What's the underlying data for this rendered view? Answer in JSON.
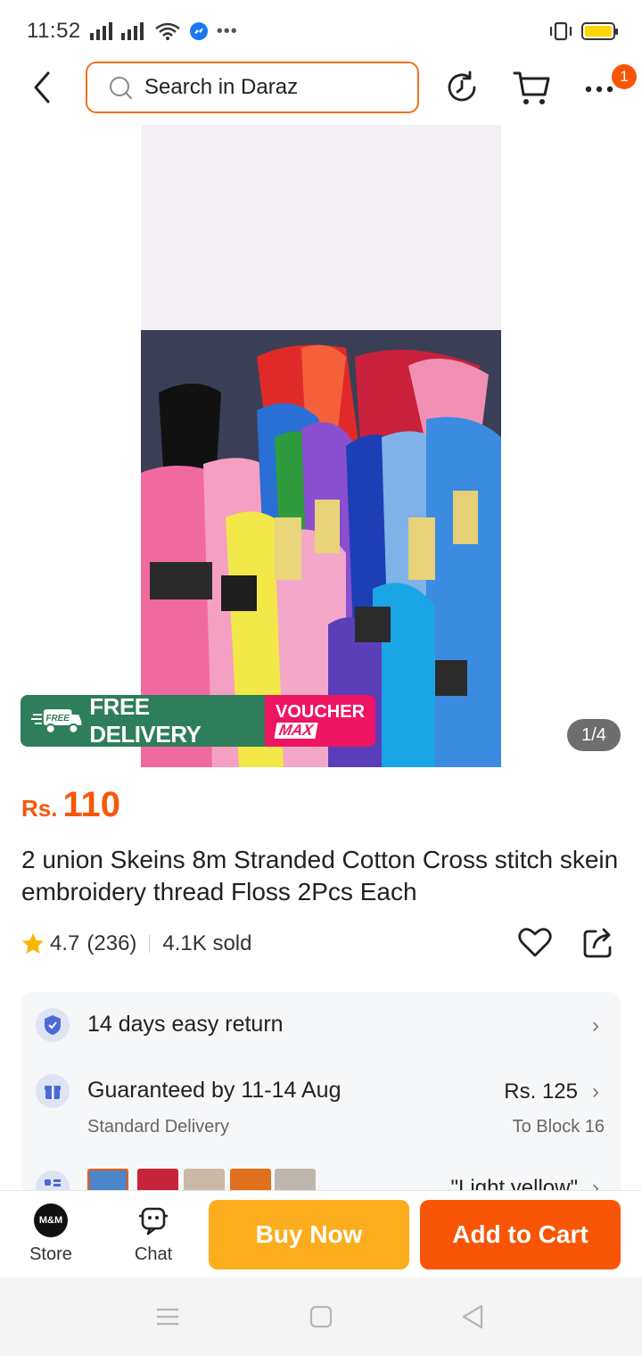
{
  "status_bar": {
    "time": "11:52"
  },
  "header": {
    "search_placeholder": "Search in Daraz",
    "notification_count": "1"
  },
  "gallery": {
    "counter": "1/4",
    "promo_free_delivery": "FREE DELIVERY",
    "promo_free_badge": "FREE",
    "promo_voucher": "VOUCHER",
    "promo_max": "MAX"
  },
  "product": {
    "currency": "Rs.",
    "price": "110",
    "title": "2 union Skeins 8m Stranded Cotton Cross stitch skein embroidery thread Floss 2Pcs Each",
    "rating": "4.7",
    "review_count": "(236)",
    "sold": "4.1K sold"
  },
  "info": {
    "return_policy": "14 days easy return",
    "delivery_guarantee": "Guaranteed by 11-14 Aug",
    "delivery_type": "Standard Delivery",
    "delivery_fee": "Rs. 125",
    "delivery_location": "To Block 16",
    "selected_variant": "\"Light yellow\""
  },
  "bottom_bar": {
    "store_label": "Store",
    "store_logo_text": "M&M",
    "chat_label": "Chat",
    "buy_now": "Buy Now",
    "add_to_cart": "Add to Cart"
  },
  "colors": {
    "accent": "#f85606",
    "buy_now": "#fcad1d",
    "free_delivery": "#2e7d5b",
    "voucher": "#ee1662"
  },
  "icons": [
    "back-icon",
    "search-icon",
    "history-icon",
    "cart-icon",
    "more-icon",
    "star-icon",
    "heart-icon",
    "share-icon",
    "shield-icon",
    "gift-icon",
    "variant-icon",
    "chevron-right-icon",
    "chat-icon",
    "menu-icon",
    "home-icon",
    "back-triangle-icon"
  ]
}
